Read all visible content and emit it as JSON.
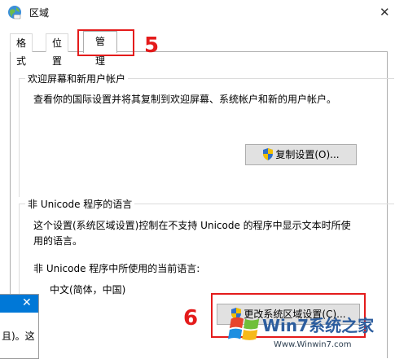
{
  "window": {
    "title": "区域",
    "close_glyph": "✕"
  },
  "tabs": [
    {
      "label": "格式"
    },
    {
      "label": "位置"
    },
    {
      "label": "管理",
      "active": true
    }
  ],
  "welcome": {
    "title": "欢迎屏幕和新用户帐户",
    "description": "查看你的国际设置并将其复制到欢迎屏幕、系统帐户和新的用户帐户。",
    "copy_button": "复制设置(O)..."
  },
  "nonunicode": {
    "title": "非 Unicode 程序的语言",
    "description_line1": "这个设置(系统区域设置)控制在不支持 Unicode 的程序中显示文本时所使",
    "description_line2": "用的语言。",
    "current_label": "非 Unicode 程序中所使用的当前语言:",
    "current_value": "中文(简体，中国)",
    "change_button": "更改系统区域设置(C)..."
  },
  "annotations": {
    "step5": "5",
    "step6": "6"
  },
  "background_window": {
    "close_glyph": "✕",
    "text": "且)。这"
  },
  "watermark": {
    "brand": "Win7系统之家",
    "url": "Www.Winwin7.com"
  },
  "colors": {
    "annotation": "#e41b1b",
    "accent": "#0078d7",
    "button_bg": "#e1e1e1"
  }
}
